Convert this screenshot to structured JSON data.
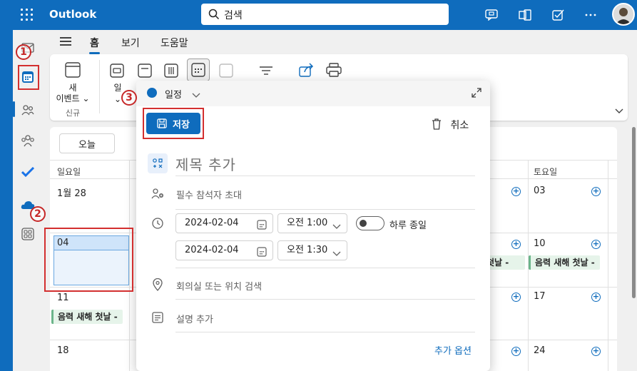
{
  "topbar": {
    "app_title": "Outlook",
    "search_placeholder": "검색"
  },
  "menu": {
    "tabs": [
      "홈",
      "보기",
      "도움말"
    ]
  },
  "ribbon": {
    "new_event": "새\n이벤트",
    "group_new": "신규",
    "day_label": "일"
  },
  "calendar": {
    "today_label": "오늘",
    "day_headers": {
      "sun": "일요일",
      "sat": "토요일"
    },
    "dates": {
      "sun1": "1월 28",
      "sun2": "04",
      "sun3": "11",
      "sun4": "18",
      "sat1": "03",
      "sat2": "10",
      "sat3": "17",
      "sat4": "24",
      "fri1": "",
      "fri2": ""
    },
    "event_text": "음력 새해 첫날 -",
    "event_text_partial": "첫날 -"
  },
  "popup": {
    "calendar_name": "일정",
    "save_label": "저장",
    "cancel_label": "취소",
    "title_placeholder": "제목 추가",
    "attendees_placeholder": "필수 참석자 초대",
    "start_date": "2024-02-04",
    "start_time": "오전 1:00",
    "end_date": "2024-02-04",
    "end_time": "오전 1:30",
    "all_day_label": "하루 종일",
    "location_placeholder": "회의실 또는 위치 검색",
    "description_placeholder": "설명 추가",
    "more_options": "추가 옵션"
  },
  "annotations": {
    "a1": "1",
    "a2": "2",
    "a3": "3"
  },
  "colors": {
    "brand": "#0f6cbd",
    "annotation": "#d32f2f",
    "event_bar": "#6bb58a"
  }
}
